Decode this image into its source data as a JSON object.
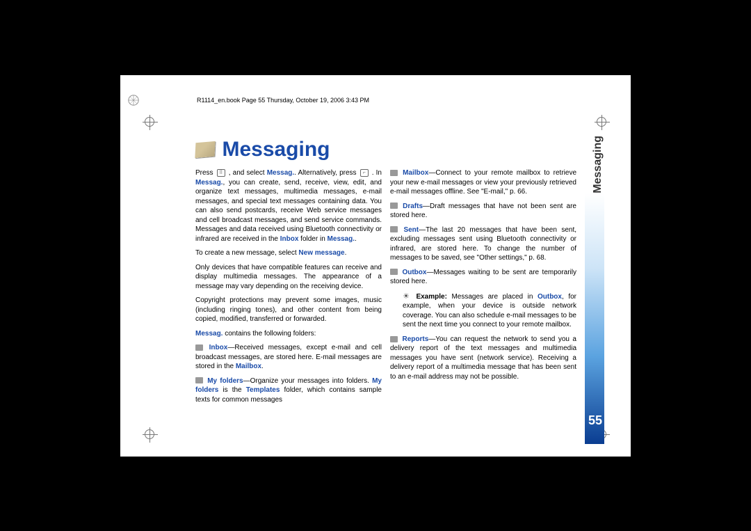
{
  "header": "R1114_en.book  Page 55  Thursday, October 19, 2006  3:43 PM",
  "title": "Messaging",
  "sideTab": "Messaging",
  "pageNumber": "55",
  "col1": {
    "p1a": "Press ",
    "p1b": " , and select ",
    "p1c": "Messag.",
    "p1d": ". Alternatively, press ",
    "p1e": " . In ",
    "p1f": "Messag.",
    "p1g": ", you can create, send, receive, view, edit, and organize text messages, multimedia messages, e-mail messages, and special text messages containing data. You can also send postcards, receive Web service messages and cell broadcast messages, and send service commands. Messages and data received using Bluetooth connectivity or infrared are received in the ",
    "p1h": "Inbox",
    "p1i": " folder in ",
    "p1j": "Messag.",
    "p1k": ".",
    "p2a": "To create a new message, select ",
    "p2b": "New message",
    "p2c": ".",
    "p3": "Only devices that have compatible features can receive and display multimedia messages. The appearance of a message may vary depending on the receiving device.",
    "p4": "Copyright protections may prevent some images, music (including ringing tones), and other content from being copied, modified, transferred or forwarded.",
    "p5a": "Messag.",
    "p5b": " contains the following folders:",
    "p6a": "Inbox",
    "p6b": "—Received messages, except e-mail and cell broadcast messages, are stored here. E-mail messages are stored in the ",
    "p6c": "Mailbox",
    "p6d": ".",
    "p7a": "My folders",
    "p7b": "—Organize your messages into folders. ",
    "p7c": "My folders",
    "p7d": " is the ",
    "p7e": "Templates",
    "p7f": " folder, which contains sample texts for common messages"
  },
  "col2": {
    "p1a": "Mailbox",
    "p1b": "—Connect to your remote mailbox to retrieve your new e-mail messages or view your previously retrieved e-mail messages offline. See \"E-mail,\" p. 66.",
    "p2a": "Drafts",
    "p2b": "—Draft messages that have not been sent are stored here.",
    "p3a": "Sent",
    "p3b": "—The last 20 messages that have been sent, excluding messages sent using Bluetooth connectivity or infrared, are stored here. To change the number of messages to be saved, see \"Other settings,\" p. 68.",
    "p4a": "Outbox",
    "p4b": "—Messages waiting to be sent are temporarily stored here.",
    "p5a": "Example:",
    "p5b": " Messages are placed in ",
    "p5c": "Outbox",
    "p5d": ", for example, when your device is outside network coverage. You can also schedule e-mail messages to be sent the next time you connect to your remote mailbox.",
    "p6a": "Reports",
    "p6b": "—You can request the network to send you a delivery report of the text messages and multimedia messages you have sent (network service). Receiving a delivery report of a multimedia message that has been sent to an e-mail address may not be possible."
  }
}
